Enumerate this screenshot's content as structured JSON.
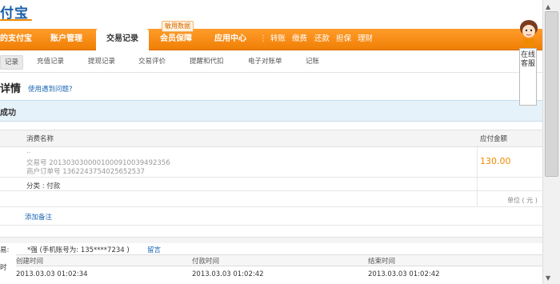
{
  "logo": {
    "text": "付宝"
  },
  "nav": {
    "items": [
      {
        "label": "的支付宝"
      },
      {
        "label": "账户管理"
      },
      {
        "label": "交易记录"
      },
      {
        "label": "会员保障"
      },
      {
        "label": "应用中心"
      }
    ],
    "badge": "敏用数据",
    "quick_links": [
      "转账",
      "缴费",
      "还款",
      "担保",
      "理财"
    ]
  },
  "subnav": {
    "items": [
      "记录",
      "充值记录",
      "提现记录",
      "交易评价",
      "提醒和代扣",
      "电子对账单",
      "记账"
    ]
  },
  "page": {
    "title": "详情",
    "help_link": "使用遇到问题?",
    "status": "成功"
  },
  "table": {
    "headers": {
      "name": "消费名称",
      "amount": "应付金额"
    },
    "row": {
      "dots": "..",
      "trade_no": "交易号 2013030300001000910039492356",
      "order_no": "商户订单号 1362243754025652537",
      "category": "分类 : 付款",
      "amount": "130.00"
    },
    "unit": "单位 ( 元 )",
    "add_note": "添加备注"
  },
  "lower": {
    "payee_label": "易:",
    "payee_text": "*强 (手机账号为: 135****7234 )",
    "payee_link": "留言",
    "time_label": "时",
    "time_headers": [
      "创建时间",
      "付款时间",
      "结束时间"
    ],
    "time_values": [
      "2013.03.03 01:02:34",
      "2013.03.03 01:02:42",
      "2013.03.03 01:02:42"
    ]
  },
  "customer_service": {
    "label": "在线客服"
  },
  "colors": {
    "nav_orange": "#f08a00",
    "link_blue": "#1a66b3",
    "status_bg": "#e6f2fa",
    "amount_orange": "#f08a00"
  }
}
